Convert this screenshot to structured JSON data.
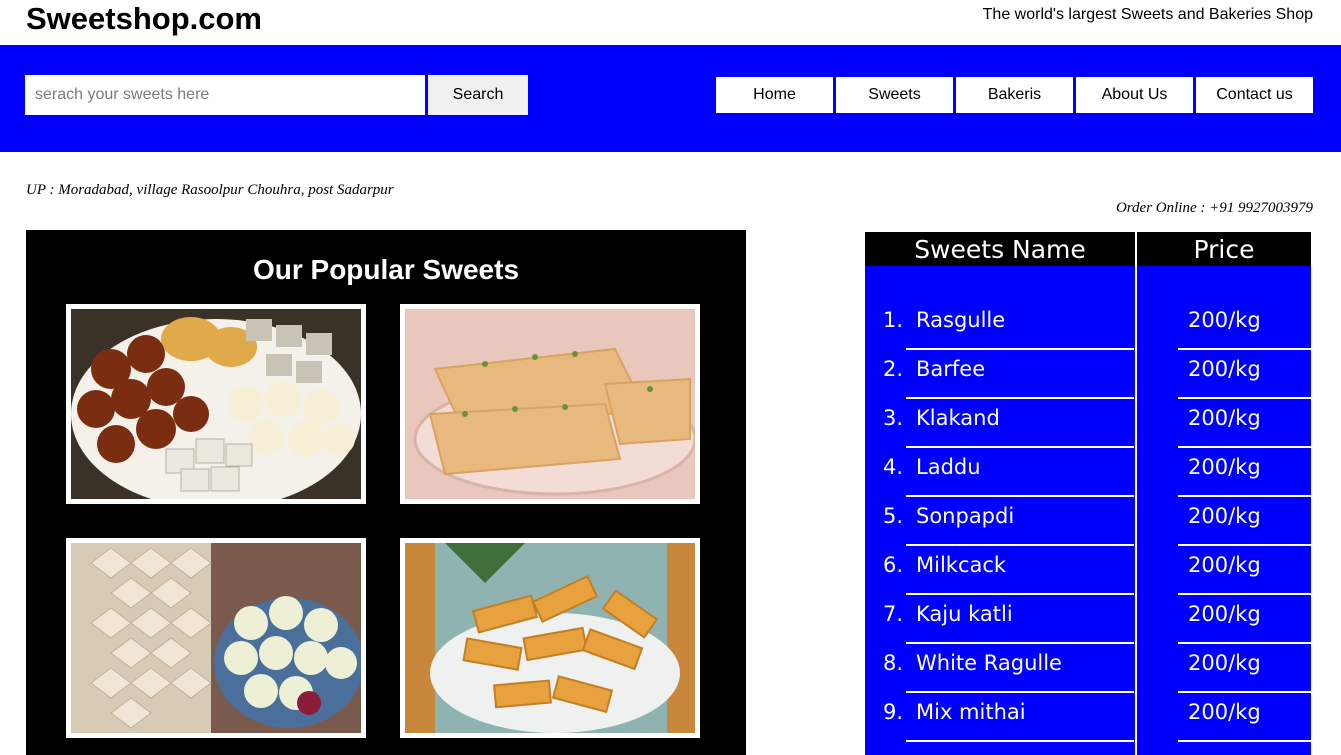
{
  "header": {
    "site_title": "Sweetshop.com",
    "tagline": "The world's largest Sweets and Bakeries Shop"
  },
  "search": {
    "placeholder": "serach your sweets here",
    "value": "",
    "button_label": "Search"
  },
  "nav": {
    "items": [
      {
        "label": "Home"
      },
      {
        "label": "Sweets"
      },
      {
        "label": "Bakeris"
      },
      {
        "label": "About Us"
      },
      {
        "label": "Contact us"
      }
    ]
  },
  "info": {
    "address": "UP : Moradabad, village Rasoolpur Chouhra, post Sadarpur",
    "order": "Order Online : +91 9927003979"
  },
  "gallery": {
    "title": "Our Popular Sweets"
  },
  "price_table": {
    "headers": {
      "name": "Sweets Name",
      "price": "Price"
    },
    "rows": [
      {
        "num": "1.",
        "name": "Rasgulle",
        "price": "200/kg"
      },
      {
        "num": "2.",
        "name": "Barfee",
        "price": "200/kg"
      },
      {
        "num": "3.",
        "name": "Klakand",
        "price": "200/kg"
      },
      {
        "num": "4.",
        "name": "Laddu",
        "price": "200/kg"
      },
      {
        "num": "5.",
        "name": "Sonpapdi",
        "price": "200/kg"
      },
      {
        "num": "6.",
        "name": "Milkcack",
        "price": "200/kg"
      },
      {
        "num": "7.",
        "name": "Kaju katli",
        "price": "200/kg"
      },
      {
        "num": "8.",
        "name": "White Ragulle",
        "price": "200/kg"
      },
      {
        "num": "9.",
        "name": "Mix mithai",
        "price": "200/kg"
      }
    ]
  },
  "colors": {
    "accent_blue": "#0000ff",
    "gallery_bg": "#000000"
  }
}
